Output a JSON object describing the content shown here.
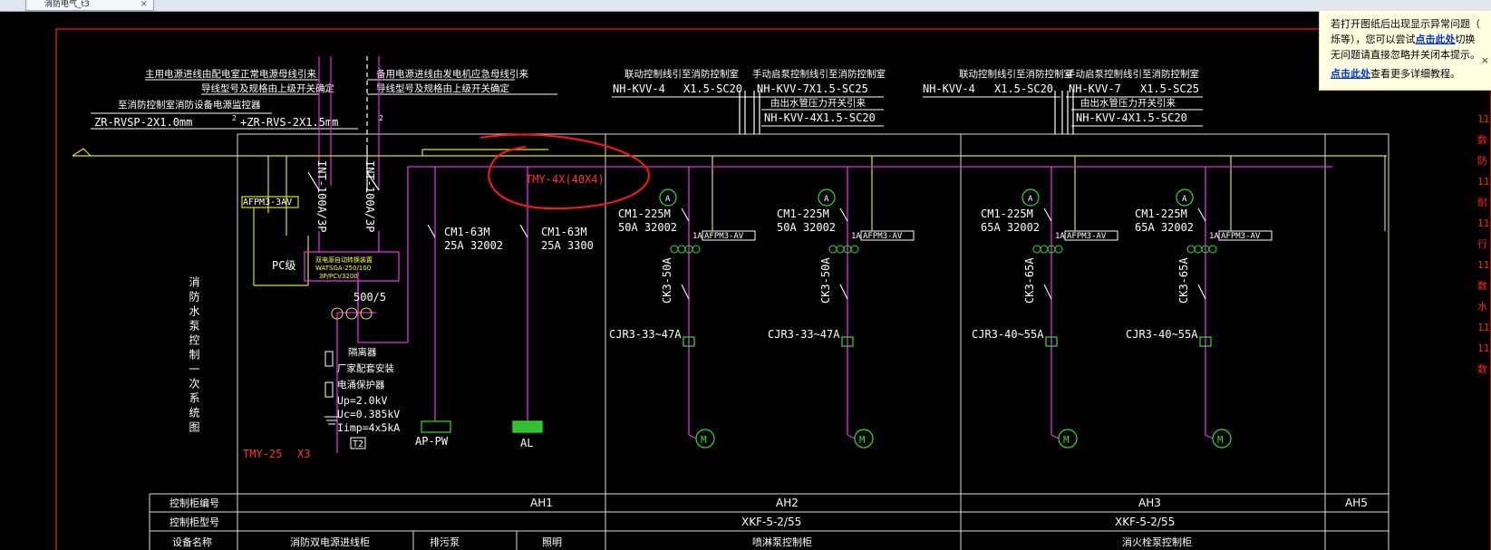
{
  "tab": {
    "title": "消防电气_t3",
    "close": "×"
  },
  "notice": {
    "line1": "若打开图纸后出现显示异常问题（",
    "line2_pre": "烁等），您可以尝试",
    "line2_link": "点击此处",
    "line2_post": "切换",
    "line3": "无问题请直接忽略并关闭本提示。",
    "line4_link": "点击此处",
    "line4_post": "查看更多详细教程。",
    "close": "×"
  },
  "right_margin": [
    "11",
    "数",
    "",
    "防",
    "11",
    "耐",
    "11",
    "行",
    "11",
    "数",
    "水",
    "11",
    "11",
    "数"
  ],
  "texts": {
    "main_in_1": "主用电源进线由配电室正常电源母线引来",
    "main_in_2": "导线型号及规格由上级开关确定",
    "spare_in_1": "备用电源进线由发电机应急母线引来",
    "spare_in_2": "导线型号及规格由上级开关确定",
    "monitor": "至消防控制室消防设备电源监控器",
    "cable_a": "ZR-RVSP-2X1.0mm",
    "cable_b": "+ZR-RVS-2X1.5mm",
    "sq2a": "2",
    "sq2b": "2",
    "ctrl1a": "联动控制线引至消防控制室",
    "ctrl1b": "手动启泵控制线引至消防控制室",
    "ctrl2a": "联动控制线引至消防控制室",
    "ctrl2b": "手动启泵控制线引至消防控制室",
    "nh1": "NH-KVV-4",
    "nh1b": "X1.5-SC20",
    "nh2": "NH-KVV-7X1.5-SC25",
    "nh3": "NH-KVV-4",
    "nh3b": "X1.5-SC20",
    "nh4": "NH-KVV-7",
    "nh4b": "X1.5-SC25",
    "press1": "由出水管压力开关引来",
    "press2": "由出水管压力开关引来",
    "nh5": "NH-KVV-4X1.5-SC20",
    "nh6": "NH-KVV-4X1.5-SC20",
    "int1": "INT-100A/3P",
    "int2": "INT-100A/3P",
    "afpm": "AFPM3-3AV",
    "pc": "PC级",
    "ats1": "双电源自动转换装置",
    "ats2": "WATSGA-250/100",
    "ats3": "3P/PCV3200",
    "ct": "500/5",
    "iso": "隔离器",
    "factory": "厂家配套安装",
    "spd": "电涌保护器",
    "up": "Up=2.0kV",
    "uc": "Uc=0.385kV",
    "iimp": "Iimp=4x5kA",
    "t2": "T2",
    "tmy25": "TMY-25",
    "x3": "X3",
    "tmy4": "TMY-4X(40X4)",
    "cm63a_1": "CM1-63M",
    "cm63a_2": "25A 32002",
    "cm63b_1": "CM1-63M",
    "cm63b_2": "25A 3300",
    "ap": "AP-PW",
    "al": "AL",
    "vertical_title": "消防水泵控制一次系统图",
    "f1a": "CM1-225M",
    "f1b": "50A 32002",
    "f2a": "CM1-225M",
    "f2b": "50A 32002",
    "f3a": "CM1-225M",
    "f3b": "65A 32002",
    "f4a": "CM1-225M",
    "f4b": "65A 32002",
    "onea": "1A",
    "afpmav": "AFPM3-AV",
    "ck50": "CK3-50A",
    "ck65": "CK3-65A",
    "cjr33": "CJR3-33~47A",
    "cjr40": "CJR3-40~55A",
    "motor": "M",
    "row1_label": "控制柜编号",
    "row2_label": "控制柜型号",
    "row3_label": "设备名称",
    "ah1": "AH1",
    "ah2": "AH2",
    "ah3": "AH3",
    "ah5": "AH5",
    "xkf1": "XKF-5-2/55",
    "xkf2": "XKF-5-2/55",
    "dev1": "消防双电源进线柜",
    "dev2": "排污泵",
    "dev3": "照明",
    "dev4": "喷淋泵控制柜",
    "dev5": "消火栓泵控制柜"
  }
}
